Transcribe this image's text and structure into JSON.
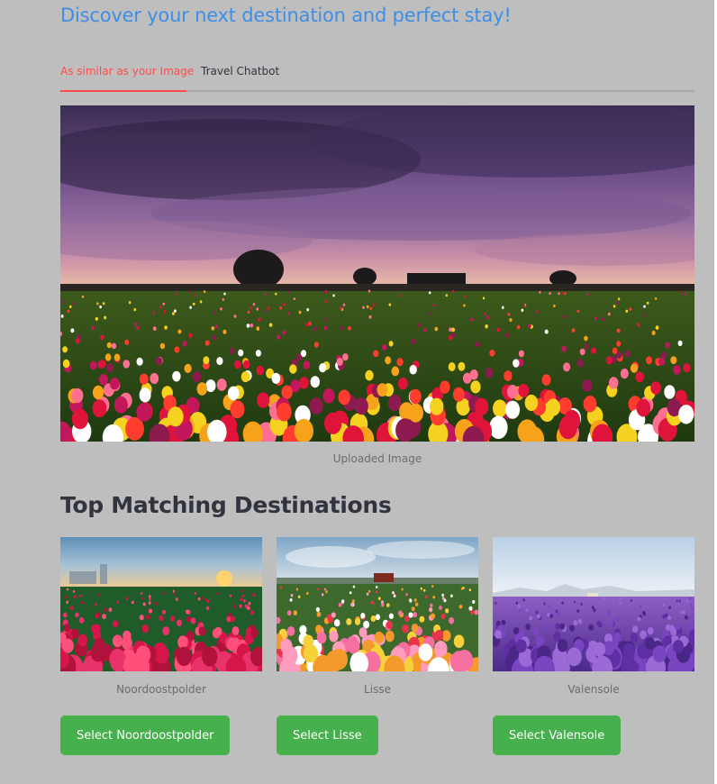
{
  "header": {
    "title": "Discover your next destination and perfect stay!"
  },
  "tabs": [
    {
      "label": "As similar as your Image",
      "active": true
    },
    {
      "label": "Travel Chatbot",
      "active": false
    }
  ],
  "upload": {
    "caption": "Uploaded Image"
  },
  "matches": {
    "title": "Top Matching Destinations",
    "items": [
      {
        "name": "Noordoostpolder",
        "button": "Select Noordoostpolder"
      },
      {
        "name": "Lisse",
        "button": "Select Lisse"
      },
      {
        "name": "Valensole",
        "button": "Select Valensole"
      }
    ]
  },
  "colors": {
    "accent": "#ff4b4b",
    "title": "#3f8ee6",
    "button": "#45b04c",
    "background": "#bebebe"
  }
}
